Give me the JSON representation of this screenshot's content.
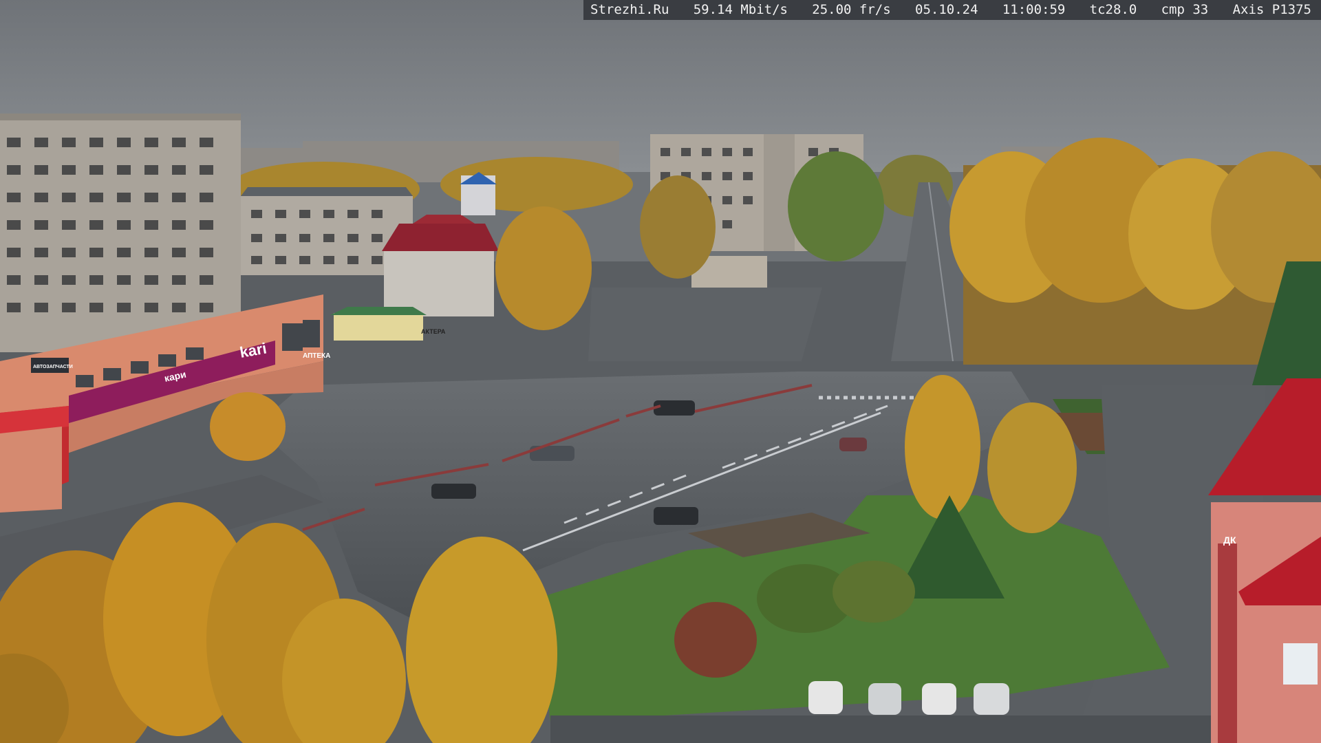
{
  "overlay": {
    "site": "Strezhi.Ru",
    "bitrate": "59.14 Mbit/s",
    "framerate": "25.00 fr/s",
    "date": "05.10.24",
    "time": "11:00:59",
    "tc": "tc28.0",
    "cmp": "cmp 33",
    "camera": "Axis P1375"
  },
  "signage": {
    "store_main": "kari",
    "store_facade": "кари",
    "pharmacy": "АПТЕКА",
    "side_sign": "АВТОЗАПЧАСТИ",
    "shop": "АКТЕРА",
    "right_building": "ДК"
  },
  "colors": {
    "sky": "#7c8086",
    "autumn_foliage": "#c9a02c",
    "asphalt": "#55595e",
    "grass": "#4f7a38",
    "kari_brand": "#8e1d5c",
    "roof_red": "#b71d2a"
  }
}
